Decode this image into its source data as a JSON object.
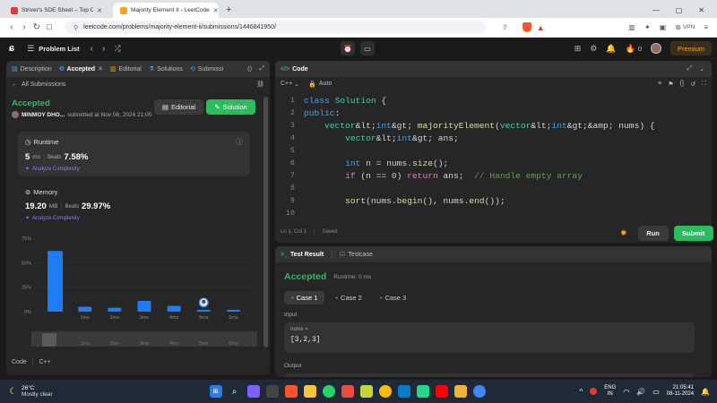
{
  "browser": {
    "tabs": [
      {
        "title": "Striver's SDE Sheet – Top Coding Ir",
        "active": false
      },
      {
        "title": "Majority Element II - LeetCode",
        "active": true
      }
    ],
    "new_tab": "+",
    "url": "leetcode.com/problems/majority-element-ii/submissions/1446841950/",
    "vpn": "VPN"
  },
  "lc_header": {
    "problem_list": "Problem List",
    "streak": "0",
    "premium": "Premium"
  },
  "left_panel": {
    "tabs": [
      "Description",
      "Accepted",
      "Editorial",
      "Solutions",
      "Submissi"
    ],
    "back_link": "All Submissions",
    "status": "Accepted",
    "user": "MINMOY DHO...",
    "submitted": "submitted at Nov 08, 2024 21:05",
    "editorial_btn": "Editorial",
    "solution_btn": "Solution",
    "runtime": {
      "label": "Runtime",
      "value": "5",
      "unit": "ms",
      "beats_label": "Beats",
      "beats": "7.58%",
      "analyze": "Analyze Complexity"
    },
    "memory": {
      "label": "Memory",
      "value": "19.20",
      "unit": "MB",
      "beats_label": "Beats",
      "beats": "29.97%",
      "analyze": "Analyze Complexity"
    },
    "footer": {
      "code": "Code",
      "lang": "C++"
    }
  },
  "chart_data": {
    "type": "bar",
    "y_ticks": [
      "75%",
      "50%",
      "25%",
      "0%"
    ],
    "ylim": [
      0,
      75
    ],
    "categories": [
      "",
      "1ms",
      "2ms",
      "3ms",
      "4ms",
      "5ms",
      "6ms"
    ],
    "values": [
      62,
      5,
      4,
      11,
      6,
      2,
      2
    ],
    "highlight_index": 5,
    "bar_color": "#1f7cf2"
  },
  "code_panel": {
    "title": "Code",
    "lang": "C++",
    "mode": "Auto",
    "status": {
      "cursor": "Ln 1, Col 1",
      "saved": "Saved"
    },
    "run": "Run",
    "submit": "Submit",
    "lines": [
      {
        "n": "1",
        "text": "class Solution {"
      },
      {
        "n": "2",
        "text": "public:"
      },
      {
        "n": "3",
        "text": "    vector<int> majorityElement(vector<int>& nums) {"
      },
      {
        "n": "4",
        "text": "        vector<int> ans;"
      },
      {
        "n": "5",
        "text": ""
      },
      {
        "n": "6",
        "text": "        int n = nums.size();"
      },
      {
        "n": "7",
        "text": "        if (n == 0) return ans;  // Handle empty array"
      },
      {
        "n": "8",
        "text": ""
      },
      {
        "n": "9",
        "text": "        sort(nums.begin(), nums.end());"
      },
      {
        "n": "10",
        "text": ""
      }
    ]
  },
  "test_panel": {
    "tabs": [
      "Test Result",
      "Testcase"
    ],
    "status": "Accepted",
    "runtime": "Runtime: 0 ms",
    "cases": [
      "Case 1",
      "Case 2",
      "Case 3"
    ],
    "input_label": "Input",
    "var_label": "nums =",
    "var_value": "[3,2,3]",
    "output_label": "Output"
  },
  "taskbar": {
    "weather_temp": "26°C",
    "weather_desc": "Mostly clear",
    "lang1": "ENG",
    "lang2": "IN",
    "time": "21:05:41",
    "date": "08-11-2024"
  }
}
